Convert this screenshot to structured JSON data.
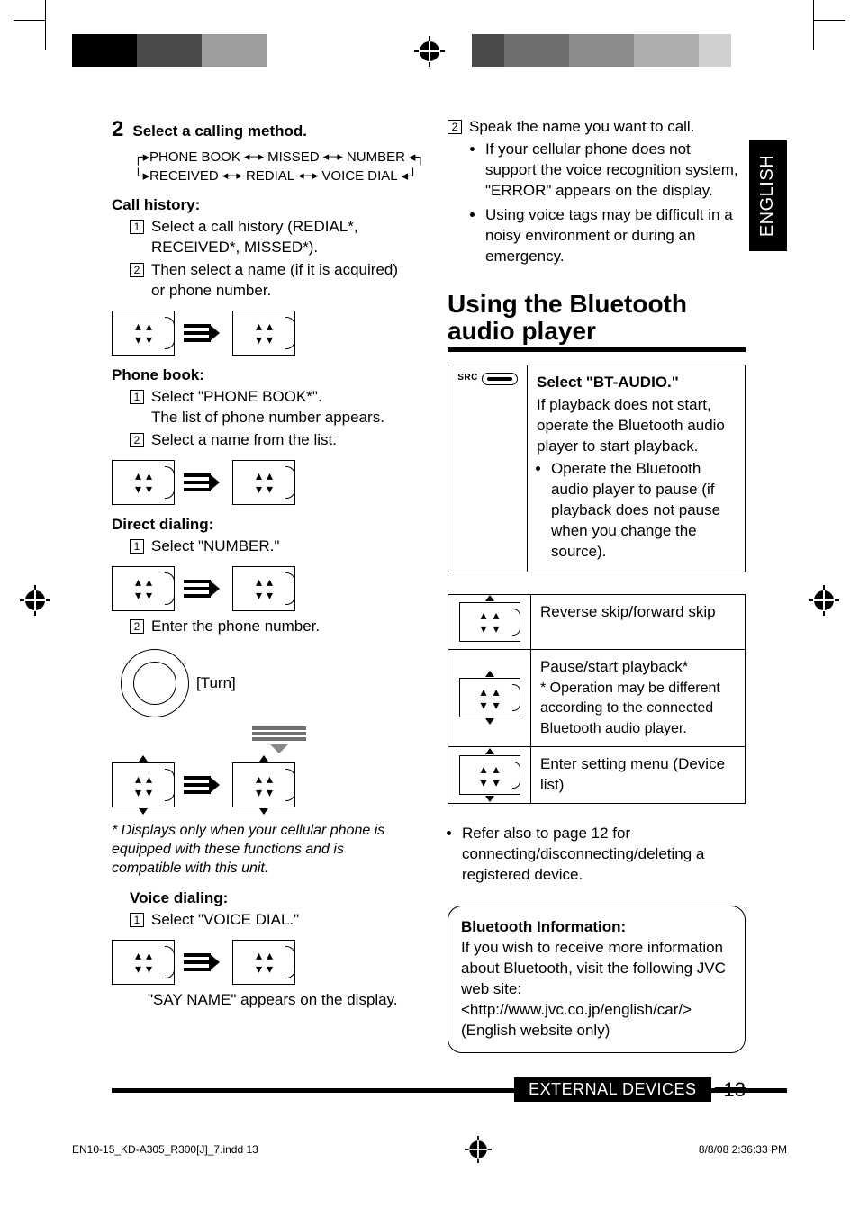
{
  "side_tab": "ENGLISH",
  "left": {
    "step_number": "2",
    "step_label": "Select a calling method.",
    "flow": {
      "row1": [
        "PHONE BOOK",
        "MISSED",
        "NUMBER"
      ],
      "row2": [
        "RECEIVED",
        "REDIAL",
        "VOICE DIAL"
      ]
    },
    "call_history": {
      "head": "Call history:",
      "items": [
        "Select a call history (REDIAL*, RECEIVED*, MISSED*).",
        "Then select a name (if it is acquired) or phone number."
      ]
    },
    "phone_book": {
      "head": "Phone book:",
      "items": [
        "Select \"PHONE BOOK*\".",
        "Select a name from the list."
      ],
      "sub": "The list of phone number appears."
    },
    "direct_dialing": {
      "head": "Direct dialing:",
      "item1": "Select \"NUMBER.\"",
      "item2": "Enter the phone number.",
      "turn": "[Turn]"
    },
    "footnote": "* Displays only when your cellular phone is equipped with these functions and is compatible with this unit.",
    "voice_dialing": {
      "head": "Voice dialing:",
      "item1": "Select \"VOICE DIAL.\"",
      "result": "\"SAY NAME\" appears on the display."
    }
  },
  "right": {
    "step2_item": "Speak the name you want to call.",
    "bullets": [
      "If your cellular phone does not support the voice recognition system, \"ERROR\" appears on the display.",
      "Using voice tags may be difficult in a noisy environment or during an emergency."
    ],
    "big_title": "Using the Bluetooth audio player",
    "src": {
      "label": "SRC",
      "head": "Select \"BT-AUDIO.\"",
      "body": "If playback does not start, operate the Bluetooth audio player to start playback.",
      "bullet": "Operate the Bluetooth audio player to pause (if playback does not pause when you change the source)."
    },
    "ctrl_table": [
      {
        "label": "Reverse skip/forward skip"
      },
      {
        "label": "Pause/start playback*",
        "sub": "* Operation may be different according to the connected Bluetooth audio player."
      },
      {
        "label": "Enter setting menu (Device list)"
      }
    ],
    "refer_note": "Refer also to page 12 for connecting/disconnecting/deleting a registered device.",
    "info": {
      "head": "Bluetooth Information:",
      "body": "If you wish to receive more information about Bluetooth, visit the following JVC web site: <http://www.jvc.co.jp/english/car/> (English website only)"
    }
  },
  "footer": {
    "section": "EXTERNAL DEVICES",
    "page": "13"
  },
  "imprint": {
    "left": "EN10-15_KD-A305_R300[J]_7.indd   13",
    "right": "8/8/08   2:36:33 PM"
  }
}
